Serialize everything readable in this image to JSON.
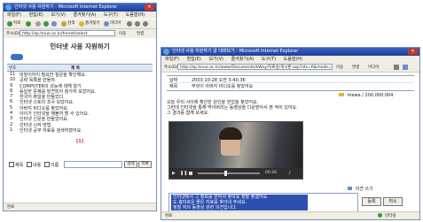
{
  "left": {
    "title": "인터넷 사용 자원하기 - Microsoft Internet Explorer",
    "menu": [
      "파일(F)",
      "편집(E)",
      "보기(V)",
      "즐겨찾기(A)",
      "도구(T)",
      "도움말(H)"
    ],
    "toolbar": {
      "back": "뒤로",
      "search": "검색",
      "favorites": "즐겨찾기",
      "media": "미디어"
    },
    "address_label": "주소(D)",
    "address": "http://sp.hnue.ac.kr/hnnet/select",
    "go": "이동",
    "links": "연결",
    "page_title": "인터넷 사용 자원하기",
    "list_header_num": "번호",
    "list_header_title": "제 목",
    "rows": [
      {
        "n": "11",
        "t": "비밀이어이 필요한 질문을 확인해요."
      },
      {
        "n": "10",
        "t": "공략 목록을 만들자."
      },
      {
        "n": "9",
        "t": "COMPUTER의 성능에 대해 알기"
      },
      {
        "n": "8",
        "t": "동일한 문제를 발견되어 참가자 보았어요."
      },
      {
        "n": "7",
        "t": "한국어 파일을 만들었다."
      },
      {
        "n": "6",
        "t": "인터넷 스토리 조사 보았어요."
      },
      {
        "n": "5",
        "t": "아버지 비디오를 찾았어요."
      },
      {
        "n": "4",
        "t": "아이가 인터넷을 해볼까 할 수 있어요."
      },
      {
        "n": "3",
        "t": "인터넷 신문을 만들었어요."
      },
      {
        "n": "2",
        "t": "인터넷 시작 방법"
      },
      {
        "n": "1",
        "t": "인터넷 공부 자료를 검색하였어요."
      }
    ],
    "page_num": "[1]",
    "search_opts": [
      "제목",
      "내용",
      "이름"
    ],
    "search_btn": "검색",
    "list_btn": "목록",
    "status": "완료"
  },
  "right": {
    "title": "인터넷 사용 자원하기 글 대화보기 - Microsoft Internet Explorer",
    "menu": [
      "파일(F)",
      "편집(E)",
      "보기(V)",
      "즐겨찾기(A)",
      "도구(T)",
      "도움말(H)"
    ],
    "address_label": "주소(D)",
    "address": "http://sp.hnue.ac.kr/www/Documents/kWay/자료실/게시판.asp?idx=6&mode=view",
    "go": "이동",
    "links": "연결",
    "media": "미디어",
    "info_label1": "날짜",
    "info_val1": "2003-10-28 오전 3:40:36",
    "info_label2": "제목",
    "info_val2": "무엇이 아버지 비디오를 찾았어요",
    "author": "mewa / 200,000,004",
    "body": [
      "오늘 우리 사이에 확인한 원인을 얻었을 찾았어요.",
      "그런데 인터넷을 통해 먹어버리는 동영상을 다운받아서 본 적이 있어요.",
      "그 결과를 함께 보세요."
    ],
    "player_time": "00:26",
    "comment_label": "의견 쓰기",
    "comment_lines": [
      "인터넷에서 그 정보를 얻어서 좋아요 정말 좋겠어요.",
      "도 흥미로운 좋은 자료를 찾아내 주세요.",
      "정말 저의 동영상 관련 의견입니다."
    ],
    "btn_register": "등록",
    "btn_cancel": "취소",
    "status": "완료",
    "zone": "인터넷"
  },
  "colors": {
    "title_bar": "#1e3f98",
    "menu_bg": "#efede4",
    "selection": "#2d4fb0"
  }
}
